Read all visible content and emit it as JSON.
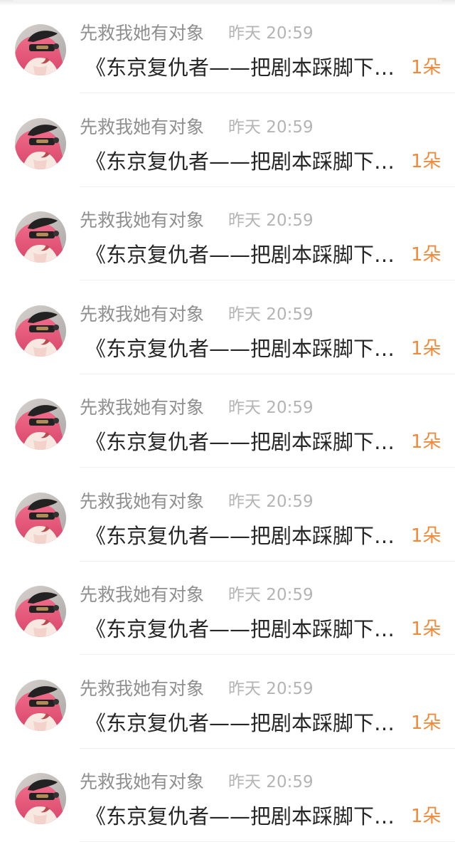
{
  "comments": [
    {
      "avatar": "user-avatar",
      "name": "先救我她有对象",
      "time": "昨天 20:59",
      "message": "《东京复仇者——把剧本踩脚下的男主重生记》",
      "count": "1朵"
    },
    {
      "avatar": "user-avatar",
      "name": "先救我她有对象",
      "time": "昨天 20:59",
      "message": "《东京复仇者——把剧本踩脚下的男主重生记》",
      "count": "1朵"
    },
    {
      "avatar": "user-avatar",
      "name": "先救我她有对象",
      "time": "昨天 20:59",
      "message": "《东京复仇者——把剧本踩脚下的男主重生记》",
      "count": "1朵"
    },
    {
      "avatar": "user-avatar",
      "name": "先救我她有对象",
      "time": "昨天 20:59",
      "message": "《东京复仇者——把剧本踩脚下的男主重生记》",
      "count": "1朵"
    },
    {
      "avatar": "user-avatar",
      "name": "先救我她有对象",
      "time": "昨天 20:59",
      "message": "《东京复仇者——把剧本踩脚下的男主重生记》",
      "count": "1朵"
    },
    {
      "avatar": "user-avatar",
      "name": "先救我她有对象",
      "time": "昨天 20:59",
      "message": "《东京复仇者——把剧本踩脚下的男主重生记》",
      "count": "1朵"
    },
    {
      "avatar": "user-avatar",
      "name": "先救我她有对象",
      "time": "昨天 20:59",
      "message": "《东京复仇者——把剧本踩脚下的男主重生记》",
      "count": "1朵"
    },
    {
      "avatar": "user-avatar",
      "name": "先救我她有对象",
      "time": "昨天 20:59",
      "message": "《东京复仇者——把剧本踩脚下的男主重生记》",
      "count": "1朵"
    },
    {
      "avatar": "user-avatar",
      "name": "先救我她有对象",
      "time": "昨天 20:59",
      "message": "《东京复仇者——把剧本踩脚下的男主重生记》",
      "count": "1朵"
    }
  ],
  "colors": {
    "name": "#8f8f8f",
    "time": "#b4b4b4",
    "message": "#262626",
    "count": "#f08a3a",
    "divider": "#efefef"
  }
}
